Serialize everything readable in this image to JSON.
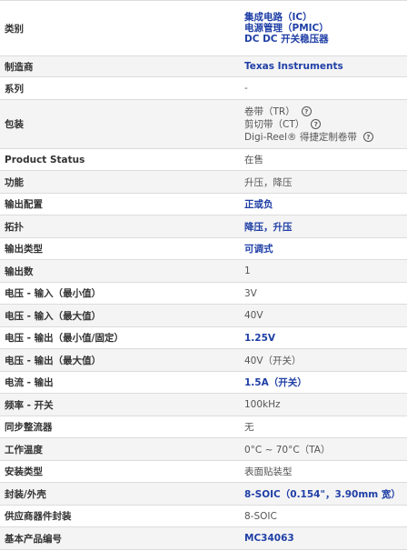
{
  "rows": [
    {
      "label": "类别",
      "lines": [
        "集成电路（IC）",
        "电源管理（PMIC）",
        "DC DC 开关稳压器"
      ],
      "style": "link"
    },
    {
      "label": "制造商",
      "value": "Texas Instruments",
      "style": "link"
    },
    {
      "label": "系列",
      "value": "-",
      "style": "text"
    },
    {
      "label": "包装",
      "packaging": [
        "卷带（TR）",
        "剪切带（CT）",
        "Digi-Reel® 得捷定制卷带"
      ],
      "style": "text"
    },
    {
      "label": "Product Status",
      "value": "在售",
      "style": "text"
    },
    {
      "label": "功能",
      "value": "升压，降压",
      "style": "text"
    },
    {
      "label": "输出配置",
      "value": "正或负",
      "style": "link"
    },
    {
      "label": "拓扑",
      "value": "降压，升压",
      "style": "link"
    },
    {
      "label": "输出类型",
      "value": "可调式",
      "style": "link"
    },
    {
      "label": "输出数",
      "value": "1",
      "style": "text"
    },
    {
      "label": "电压 - 输入（最小值）",
      "value": "3V",
      "style": "text"
    },
    {
      "label": "电压 - 输入（最大值）",
      "value": "40V",
      "style": "text"
    },
    {
      "label": "电压 - 输出（最小值/固定）",
      "value": "1.25V",
      "style": "link"
    },
    {
      "label": "电压 - 输出（最大值）",
      "value": "40V（开关）",
      "style": "text"
    },
    {
      "label": "电流 - 输出",
      "value": "1.5A（开关）",
      "style": "link"
    },
    {
      "label": "频率 - 开关",
      "value": "100kHz",
      "style": "text"
    },
    {
      "label": "同步整流器",
      "value": "无",
      "style": "text"
    },
    {
      "label": "工作温度",
      "value": "0°C ~ 70°C（TA）",
      "style": "text"
    },
    {
      "label": "安装类型",
      "value": "表面贴装型",
      "style": "text"
    },
    {
      "label": "封装/外壳",
      "value": "8-SOIC（0.154\"，3.90mm 宽）",
      "style": "link"
    },
    {
      "label": "供应商器件封装",
      "value": "8-SOIC",
      "style": "text"
    },
    {
      "label": "基本产品编号",
      "value": "MC34063",
      "style": "link"
    }
  ],
  "help_icon_glyph": "?",
  "colors": {
    "link": "#1f3fa6",
    "text": "#555555",
    "label": "#333333",
    "row_alt": "#f4f4f4",
    "border": "#dcdcdc"
  }
}
